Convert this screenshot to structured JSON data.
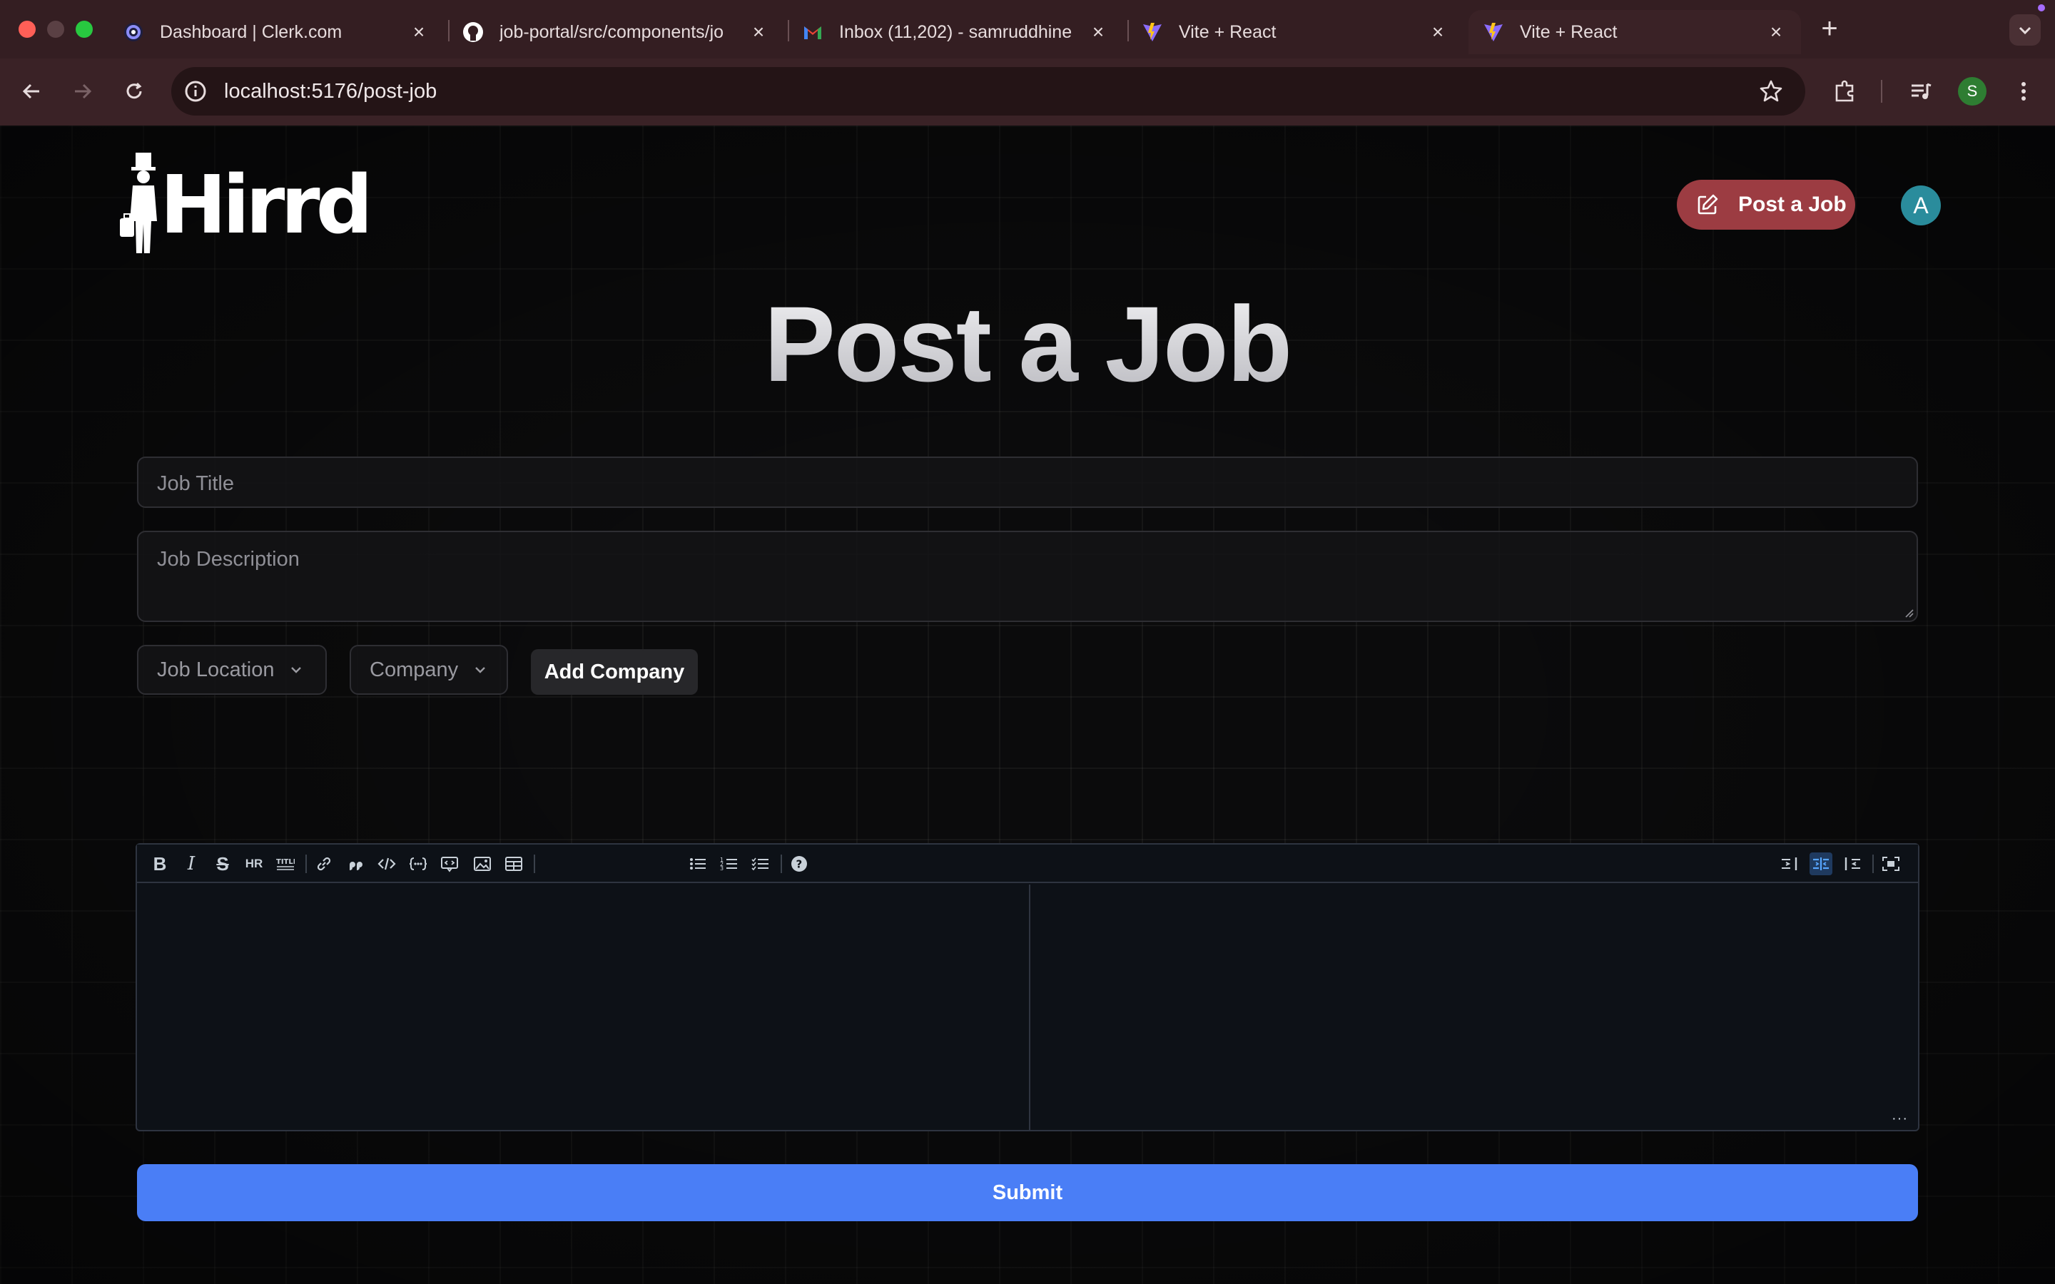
{
  "browser": {
    "tabs": [
      {
        "title": "Dashboard | Clerk.com",
        "icon": "clerk-icon"
      },
      {
        "title": "job-portal/src/components/jo",
        "icon": "github-icon"
      },
      {
        "title": "Inbox (11,202) - samruddhine",
        "icon": "gmail-icon"
      },
      {
        "title": "Vite + React",
        "icon": "vite-icon"
      },
      {
        "title": "Vite + React",
        "icon": "vite-icon",
        "active": true
      }
    ],
    "url": "localhost:5176/post-job",
    "profile_initial": "S"
  },
  "header": {
    "logo_text": "Hirrd",
    "post_job_label": "Post a Job",
    "avatar_initial": "A"
  },
  "main": {
    "title": "Post a Job",
    "job_title_placeholder": "Job Title",
    "job_description_placeholder": "Job Description",
    "location_select": "Job Location",
    "company_select": "Company",
    "add_company_label": "Add Company",
    "submit_label": "Submit"
  },
  "editor": {
    "toolbar_left": [
      "B",
      "I",
      "S",
      "HR",
      "TITLE",
      "link",
      "quote",
      "code",
      "code-block",
      "comment",
      "image",
      "table",
      "ul",
      "ol",
      "checklist",
      "help"
    ],
    "toolbar_right": [
      "edit-mode",
      "live-mode",
      "preview-mode",
      "fullscreen"
    ],
    "active_mode": "live-mode"
  },
  "colors": {
    "accent_post_button": "#9c3c42",
    "submit_blue": "#4a7ef6",
    "avatar_teal": "#2a8c9c"
  }
}
